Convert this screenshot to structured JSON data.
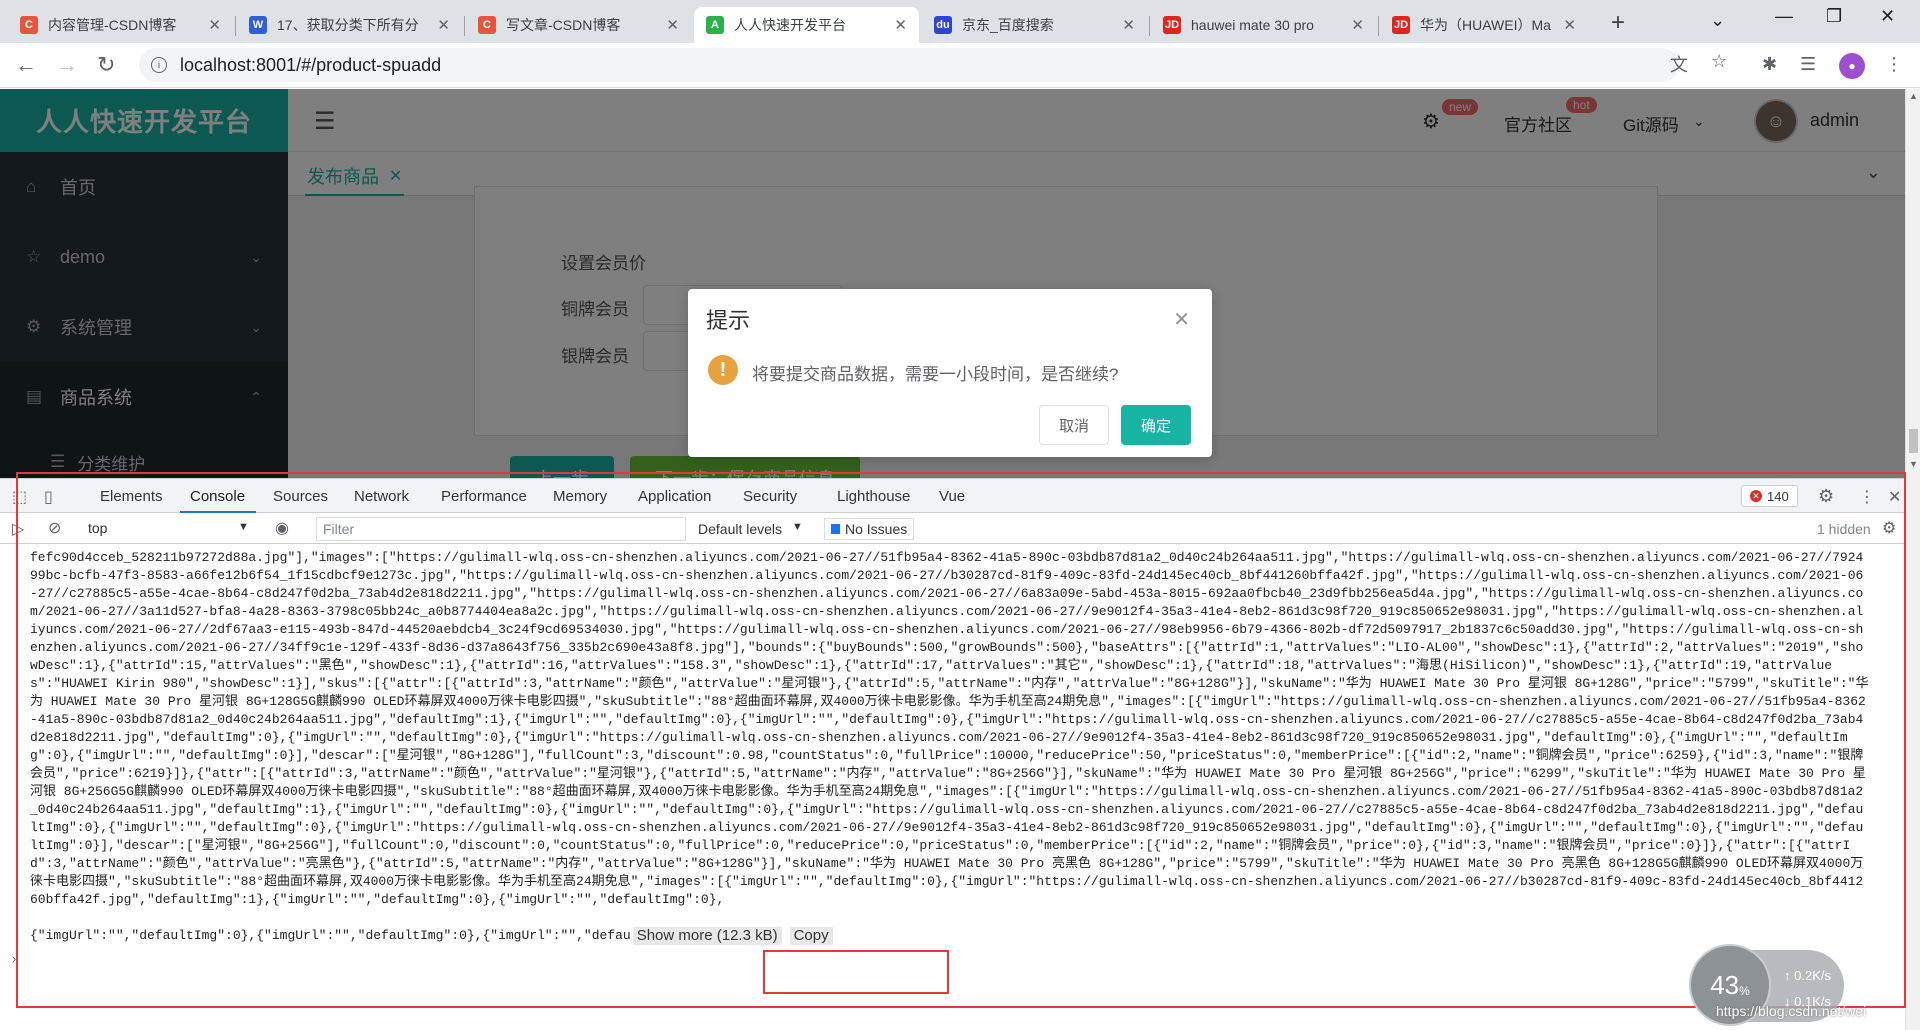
{
  "browser": {
    "tabs": [
      {
        "title": "内容管理-CSDN博客",
        "favicon": "C",
        "color": "#e8553d"
      },
      {
        "title": "17、获取分类下所有分",
        "favicon": "W",
        "color": "#2f5fd7"
      },
      {
        "title": "写文章-CSDN博客",
        "favicon": "C",
        "color": "#e8553d"
      },
      {
        "title": "人人快速开发平台",
        "favicon": "A",
        "color": "#2bb04a"
      },
      {
        "title": "京东_百度搜索",
        "favicon": "du",
        "color": "#2f44d6"
      },
      {
        "title": "hauwei mate 30 pro",
        "favicon": "JD",
        "color": "#e1251b"
      },
      {
        "title": "华为（HUAWEI）Ma",
        "favicon": "JD",
        "color": "#e1251b"
      }
    ],
    "url": "localhost:8001/#/product-spuadd"
  },
  "app": {
    "brand": "人人快速开发平台",
    "menu": {
      "home": "首页",
      "demo": "demo",
      "system": "系统管理",
      "product": "商品系统",
      "category": "分类维护"
    },
    "topbar": {
      "badge_new": "new",
      "community": "官方社区",
      "badge_hot": "hot",
      "git": "Git源码",
      "user": "admin"
    },
    "page_tab": "发布商品",
    "form": {
      "member_price": "设置会员价",
      "bronze": "铜牌会员",
      "silver": "银牌会员"
    },
    "buttons": {
      "prev": "上一步",
      "next": "下一步：保存商品信息"
    },
    "dialog": {
      "title": "提示",
      "message": "将要提交商品数据，需要一小段时间，是否继续?",
      "cancel": "取消",
      "confirm": "确定"
    }
  },
  "devtools": {
    "tabs": [
      "Elements",
      "Console",
      "Sources",
      "Network",
      "Performance",
      "Memory",
      "Application",
      "Security",
      "Lighthouse",
      "Vue"
    ],
    "active_tab": "Console",
    "error_count": "140",
    "context": "top",
    "filter_placeholder": "Filter",
    "levels": "Default levels",
    "issues": "No Issues",
    "hidden": "1 hidden",
    "console_text": "fefc90d4cceb_528211b97272d88a.jpg\"],\"images\":[\"https://gulimall-wlq.oss-cn-shenzhen.aliyuncs.com/2021-06-27//51fb95a4-8362-41a5-890c-03bdb87d81a2_0d40c24b264aa511.jpg\",\"https://gulimall-wlq.oss-cn-shenzhen.aliyuncs.com/2021-06-27//792499bc-bcfb-47f3-8583-a66fe12b6f54_1f15cdbcf9e1273c.jpg\",\"https://gulimall-wlq.oss-cn-shenzhen.aliyuncs.com/2021-06-27//b30287cd-81f9-409c-83fd-24d145ec40cb_8bf441260bffa42f.jpg\",\"https://gulimall-wlq.oss-cn-shenzhen.aliyuncs.com/2021-06-27//c27885c5-a55e-4cae-8b64-c8d247f0d2ba_73ab4d2e818d2211.jpg\",\"https://gulimall-wlq.oss-cn-shenzhen.aliyuncs.com/2021-06-27//6a83a09e-5abd-453a-8015-692aa0fbcb40_23d9fbb256ea5d4a.jpg\",\"https://gulimall-wlq.oss-cn-shenzhen.aliyuncs.com/2021-06-27//3a11d527-bfa8-4a28-8363-3798c05bb24c_a0b8774404ea8a2c.jpg\",\"https://gulimall-wlq.oss-cn-shenzhen.aliyuncs.com/2021-06-27//9e9012f4-35a3-41e4-8eb2-861d3c98f720_919c850652e98031.jpg\",\"https://gulimall-wlq.oss-cn-shenzhen.aliyuncs.com/2021-06-27//2df67aa3-e115-493b-847d-44520aebdcb4_3c24f9cd69534030.jpg\",\"https://gulimall-wlq.oss-cn-shenzhen.aliyuncs.com/2021-06-27//98eb9956-6b79-4366-802b-df72d5097917_2b1837c6c50add30.jpg\",\"https://gulimall-wlq.oss-cn-shenzhen.aliyuncs.com/2021-06-27//34ff9c1e-129f-433f-8d36-d37a8643f756_335b2c690e43a8f8.jpg\"],\"bounds\":{\"buyBounds\":500,\"growBounds\":500},\"baseAttrs\":[{\"attrId\":1,\"attrValues\":\"LIO-AL00\",\"showDesc\":1},{\"attrId\":2,\"attrValues\":\"2019\",\"showDesc\":1},{\"attrId\":15,\"attrValues\":\"黑色\",\"showDesc\":1},{\"attrId\":16,\"attrValues\":\"158.3\",\"showDesc\":1},{\"attrId\":17,\"attrValues\":\"其它\",\"showDesc\":1},{\"attrId\":18,\"attrValues\":\"海思(HiSilicon)\",\"showDesc\":1},{\"attrId\":19,\"attrValues\":\"HUAWEI Kirin 980\",\"showDesc\":1}],\"skus\":[{\"attr\":[{\"attrId\":3,\"attrName\":\"颜色\",\"attrValue\":\"星河银\"},{\"attrId\":5,\"attrName\":\"内存\",\"attrValue\":\"8G+128G\"}],\"skuName\":\"华为 HUAWEI Mate 30 Pro 星河银 8G+128G\",\"price\":\"5799\",\"skuTitle\":\"华为 HUAWEI Mate 30 Pro 星河银 8G+128G5G麒麟990 OLED环幕屏双4000万徕卡电影四摄\",\"skuSubtitle\":\"88°超曲面环幕屏,双4000万徕卡电影影像。华为手机至高24期免息\",\"images\":[{\"imgUrl\":\"https://gulimall-wlq.oss-cn-shenzhen.aliyuncs.com/2021-06-27//51fb95a4-8362-41a5-890c-03bdb87d81a2_0d40c24b264aa511.jpg\",\"defaultImg\":1},{\"imgUrl\":\"\",\"defaultImg\":0},{\"imgUrl\":\"\",\"defaultImg\":0},{\"imgUrl\":\"https://gulimall-wlq.oss-cn-shenzhen.aliyuncs.com/2021-06-27//c27885c5-a55e-4cae-8b64-c8d247f0d2ba_73ab4d2e818d2211.jpg\",\"defaultImg\":0},{\"imgUrl\":\"\",\"defaultImg\":0},{\"imgUrl\":\"https://gulimall-wlq.oss-cn-shenzhen.aliyuncs.com/2021-06-27//9e9012f4-35a3-41e4-8eb2-861d3c98f720_919c850652e98031.jpg\",\"defaultImg\":0},{\"imgUrl\":\"\",\"defaultImg\":0},{\"imgUrl\":\"\",\"defaultImg\":0}],\"descar\":[\"星河银\",\"8G+128G\"],\"fullCount\":3,\"discount\":0.98,\"countStatus\":0,\"fullPrice\":10000,\"reducePrice\":50,\"priceStatus\":0,\"memberPrice\":[{\"id\":2,\"name\":\"铜牌会员\",\"price\":6259},{\"id\":3,\"name\":\"银牌会员\",\"price\":6219}]},{\"attr\":[{\"attrId\":3,\"attrName\":\"颜色\",\"attrValue\":\"星河银\"},{\"attrId\":5,\"attrName\":\"内存\",\"attrValue\":\"8G+256G\"}],\"skuName\":\"华为 HUAWEI Mate 30 Pro 星河银 8G+256G\",\"price\":\"6299\",\"skuTitle\":\"华为 HUAWEI Mate 30 Pro 星河银 8G+256G5G麒麟990 OLED环幕屏双4000万徕卡电影四摄\",\"skuSubtitle\":\"88°超曲面环幕屏,双4000万徕卡电影影像。华为手机至高24期免息\",\"images\":[{\"imgUrl\":\"https://gulimall-wlq.oss-cn-shenzhen.aliyuncs.com/2021-06-27//51fb95a4-8362-41a5-890c-03bdb87d81a2_0d40c24b264aa511.jpg\",\"defaultImg\":1},{\"imgUrl\":\"\",\"defaultImg\":0},{\"imgUrl\":\"\",\"defaultImg\":0},{\"imgUrl\":\"https://gulimall-wlq.oss-cn-shenzhen.aliyuncs.com/2021-06-27//c27885c5-a55e-4cae-8b64-c8d247f0d2ba_73ab4d2e818d2211.jpg\",\"defaultImg\":0},{\"imgUrl\":\"\",\"defaultImg\":0},{\"imgUrl\":\"https://gulimall-wlq.oss-cn-shenzhen.aliyuncs.com/2021-06-27//9e9012f4-35a3-41e4-8eb2-861d3c98f720_919c850652e98031.jpg\",\"defaultImg\":0},{\"imgUrl\":\"\",\"defaultImg\":0},{\"imgUrl\":\"\",\"defaultImg\":0}],\"descar\":[\"星河银\",\"8G+256G\"],\"fullCount\":0,\"discount\":0,\"countStatus\":0,\"fullPrice\":0,\"reducePrice\":0,\"priceStatus\":0,\"memberPrice\":[{\"id\":2,\"name\":\"铜牌会员\",\"price\":0},{\"id\":3,\"name\":\"银牌会员\",\"price\":0}]},{\"attr\":[{\"attrId\":3,\"attrName\":\"颜色\",\"attrValue\":\"亮黑色\"},{\"attrId\":5,\"attrName\":\"内存\",\"attrValue\":\"8G+128G\"}],\"skuName\":\"华为 HUAWEI Mate 30 Pro 亮黑色 8G+128G\",\"price\":\"5799\",\"skuTitle\":\"华为 HUAWEI Mate 30 Pro 亮黑色 8G+128G5G麒麟990 OLED环幕屏双4000万徕卡电影四摄\",\"skuSubtitle\":\"88°超曲面环幕屏,双4000万徕卡电影影像。华为手机至高24期免息\",\"images\":[{\"imgUrl\":\"\",\"defaultImg\":0},{\"imgUrl\":\"https://gulimall-wlq.oss-cn-shenzhen.aliyuncs.com/2021-06-27//b30287cd-81f9-409c-83fd-24d145ec40cb_8bf441260bffa42f.jpg\",\"defaultImg\":1},{\"imgUrl\":\"\",\"defaultImg\":0},{\"imgUrl\":\"\",\"defaultImg\":0},",
    "console_tail": "{\"imgUrl\":\"\",\"defaultImg\":0},{\"imgUrl\":\"\",\"defaultImg\":0},{\"imgUrl\":\"\",\"defau",
    "show_more": "Show more (12.3 kB)",
    "copy": "Copy"
  },
  "network_widget": {
    "percent": "43",
    "percent_sign": "%",
    "up": "0.2K/s",
    "down": "0.1K/s"
  },
  "watermark": "https://blog.csdn.net/wei"
}
